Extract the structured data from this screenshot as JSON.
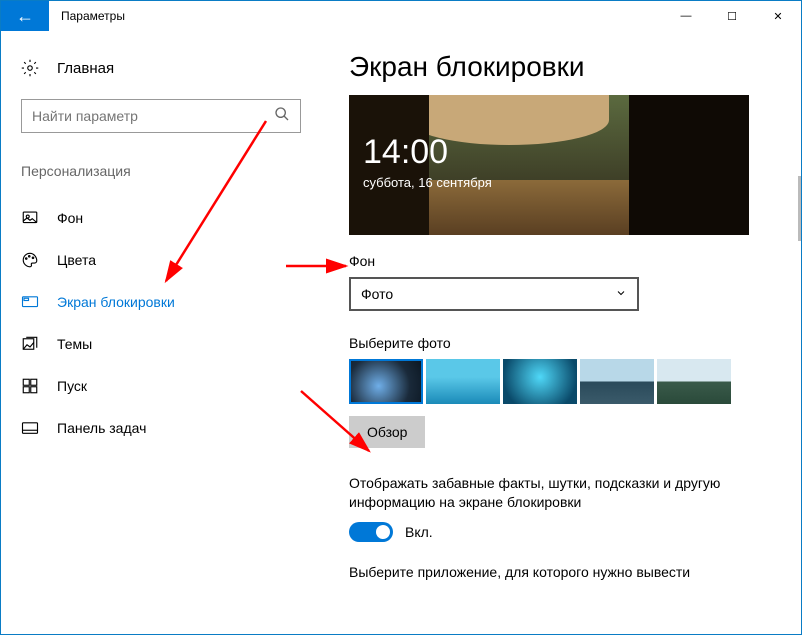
{
  "titlebar": {
    "back_icon": "←",
    "title": "Параметры",
    "min": "—",
    "max": "☐",
    "close": "✕"
  },
  "sidebar": {
    "home_label": "Главная",
    "search_placeholder": "Найти параметр",
    "category": "Персонализация",
    "items": [
      {
        "id": "background",
        "label": "Фон"
      },
      {
        "id": "colors",
        "label": "Цвета"
      },
      {
        "id": "lockscreen",
        "label": "Экран блокировки"
      },
      {
        "id": "themes",
        "label": "Темы"
      },
      {
        "id": "start",
        "label": "Пуск"
      },
      {
        "id": "taskbar",
        "label": "Панель задач"
      }
    ]
  },
  "panel": {
    "heading": "Экран блокировки",
    "preview_time": "14:00",
    "preview_date": "суббота, 16 сентября",
    "bg_label": "Фон",
    "bg_value": "Фото",
    "choose_label": "Выберите фото",
    "browse_label": "Обзор",
    "tips_text": "Отображать забавные факты, шутки, подсказки и другую информацию на экране блокировки",
    "toggle_label": "Вкл.",
    "apps_text": "Выберите приложение, для которого нужно вывести"
  }
}
